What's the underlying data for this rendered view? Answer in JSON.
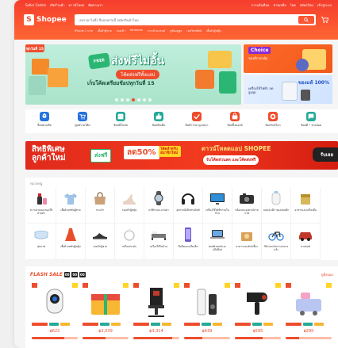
{
  "header": {
    "topbar_left": [
      "Seller Centre",
      "เปิดร้านค้า",
      "ดาวน์โหลด",
      "ติดตามเรา"
    ],
    "topbar_right": [
      "การแจ้งเตือน",
      "ช่วยเหลือ",
      "ไทย",
      "สมัครใหม่",
      "เข้าสู่ระบบ"
    ],
    "logo_text": "Shopee",
    "search_placeholder": "ลดราคาไม่ยั้ง ช็อปเลยวันนี้ สมัครสินค้าใหม่",
    "suggestions": [
      "iPhone 1 บาท",
      "เสื้อผ้าผู้ชาย",
      "รองเท้า",
      "Nintendo",
      "กระเป๋าแบรนด์",
      "หูฟังบลูทูธ",
      "เคสโทรศัพท์",
      "เสื้อผ้าผู้หญิง"
    ]
  },
  "main_banner": {
    "date_badge": "ทุกวันที่ 15",
    "free_badge": "FREE",
    "title": "ส่งฟรีไม่อั้น",
    "subtitle": "โค้ดส่งฟรีทั้งแอป",
    "line": "เก็บโค้ดเตรียมช้อปทุกวันที่ 15",
    "dots": 7,
    "active_dot": 3
  },
  "side_banners": [
    {
      "title": "Choice",
      "subtitle": "ของดีราคาคุ้ม"
    },
    {
      "title": "ของแท้ 100%",
      "subtitle": "เครื่องใช้ไฟฟ้า ลดสูงสุด"
    }
  ],
  "quick_links": [
    {
      "label": "ช็อปตามดีล",
      "icon": "rocket-icon",
      "color": "#2673dd"
    },
    {
      "label": "ศูนย์รวมโค้ด",
      "icon": "cart-icon",
      "color": "#2673dd"
    },
    {
      "label": "ช้อปมีโบนัส",
      "icon": "shop-icon",
      "color": "#26aa99"
    },
    {
      "label": "ช้อปดีลเด็ด",
      "icon": "thumb-icon",
      "color": "#26aa99"
    },
    {
      "label": "สินค้าราคาถูกเหมา",
      "icon": "check-icon",
      "color": "#ee4d2d"
    },
    {
      "label": "ช้อปปิ้งมอลล์",
      "icon": "bag-icon",
      "color": "#ee4d2d"
    },
    {
      "label": "ช้อปรักษ์โลก",
      "icon": "coin-icon",
      "color": "#ee4d2d"
    },
    {
      "label": "ช้อปดี • จ่ายน้อย",
      "icon": "chat-icon",
      "color": "#26aa99"
    }
  ],
  "promo": {
    "left": "สิทธิพิเศษ\nลูกค้าใหม่",
    "code_label": "ส่งฟรี",
    "discount": "ลด50%",
    "new_user": "โค้ดสำหรับ สมาชิกใหม่",
    "cta_title": "ดาวน์โหลดแอป SHOPEE",
    "cta_sub": "รับโค้ดส่วนลด และโค้ดส่งฟรี",
    "button": "รับเลย"
  },
  "categories": {
    "title": "หมวดหมู่",
    "items": [
      {
        "label": "ความงามและของใช้ส่วนตัว",
        "icon": "cosmetics-icon"
      },
      {
        "label": "เสื้อผ้าแฟชั่นผู้ชาย",
        "icon": "shirt-icon"
      },
      {
        "label": "กระเป๋า",
        "icon": "handbag-icon"
      },
      {
        "label": "รองเท้าผู้หญิง",
        "icon": "heels-icon"
      },
      {
        "label": "นาฬิกาและแว่นตา",
        "icon": "watch-icon"
      },
      {
        "label": "อุปกรณ์อิเล็กทรอนิกส์",
        "icon": "headphones-icon"
      },
      {
        "label": "เครื่องใช้ไฟฟ้าภายในบ้าน",
        "icon": "tv-icon"
      },
      {
        "label": "กล้องและอุปกรณ์ถ่ายภาพ",
        "icon": "camera-icon"
      },
      {
        "label": "แม่และเด็ก ของเล่นเด็ก",
        "icon": "baby-icon"
      },
      {
        "label": "อาหารและเครื่องดื่ม",
        "icon": "food-icon"
      },
      {
        "label": "สุขภาพ",
        "icon": "mask-icon"
      },
      {
        "label": "เสื้อผ้าแฟชั่นผู้หญิง",
        "icon": "dress-icon"
      },
      {
        "label": "รองเท้าผู้ชาย",
        "icon": "sneaker-icon"
      },
      {
        "label": "เครื่องประดับ",
        "icon": "jewelry-icon"
      },
      {
        "label": "เครื่องใช้ในบ้าน",
        "icon": "bed-icon"
      },
      {
        "label": "มือถือและแท็บเล็ต",
        "icon": "phone-icon"
      },
      {
        "label": "คอมพิวเตอร์และแล็ปท็อป",
        "icon": "laptop-icon"
      },
      {
        "label": "อาหารและสัตว์เลี้ยง",
        "icon": "pet-icon"
      },
      {
        "label": "กีฬาและกิจกรรมกลางแจ้ง",
        "icon": "bike-icon"
      },
      {
        "label": "ยานยนต์",
        "icon": "car-icon"
      }
    ]
  },
  "flash_sale": {
    "title": "FLASH SALE",
    "clock": [
      "00",
      "00",
      "00"
    ],
    "view_all": "ดูทั้งหมด",
    "products": [
      {
        "price": "฿622",
        "icon": "camera-icon",
        "sold_fraction": 0.7
      },
      {
        "price": "฿2,039",
        "icon": "gift-box-icon",
        "sold_fraction": 0.5
      },
      {
        "price": "฿3,314",
        "icon": "gaming-chair-icon",
        "sold_fraction": 0.85
      },
      {
        "price": "฿439",
        "icon": "speaker-icon",
        "sold_fraction": 0.4
      },
      {
        "price": "฿595",
        "icon": "hairdryer-icon",
        "sold_fraction": 0.6
      },
      {
        "price": "฿295",
        "icon": "toy-icon",
        "sold_fraction": 0.3
      }
    ]
  },
  "colors": {
    "brand": "#ee4d2d",
    "banner_green": "#bfeedd",
    "promo_red": "#e02a1b"
  }
}
